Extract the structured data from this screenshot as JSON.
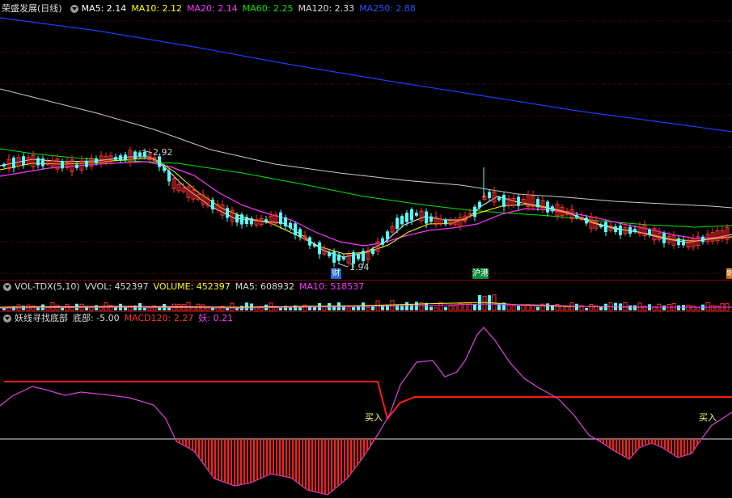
{
  "main": {
    "stock_title": "荣盛发展(日线)",
    "ma5": "MA5: 2.14",
    "ma10": "MA10: 2.12",
    "ma20": "MA20: 2.14",
    "ma60": "MA60: 2.25",
    "ma120": "MA120: 2.33",
    "ma250": "MA250: 2.88",
    "high_label": "2.92",
    "low_label": "1.94",
    "marker_cai": "财",
    "marker_gang": "沪港",
    "marker_right": "融"
  },
  "vol": {
    "title": "VOL-TDX(5,10)",
    "vvol": "VVOL: 452397",
    "volume": "VOLUME: 452397",
    "ma5": "MA5: 608932",
    "ma10": "MA10: 518537"
  },
  "ind": {
    "title": "妖线寻找底部",
    "bottom": "底部: -5.00",
    "macd": "MACD120: 2.27",
    "yao": "妖: 0.21",
    "buy1": "买入",
    "buy2": "买入"
  },
  "colors": {
    "up": "#ff3030",
    "down": "#54ffff",
    "ma5": "#ffffff",
    "ma10": "#ffff00",
    "ma20": "#ff33ff",
    "ma60": "#00e600",
    "ma120": "#c8c8c8",
    "ma250": "#1e3cff"
  },
  "chart_data": [
    {
      "type": "candlestick",
      "title": "荣盛发展(日线)",
      "series": [
        {
          "name": "MA5",
          "last": 2.14
        },
        {
          "name": "MA10",
          "last": 2.12
        },
        {
          "name": "MA20",
          "last": 2.14
        },
        {
          "name": "MA60",
          "last": 2.25
        },
        {
          "name": "MA120",
          "last": 2.33
        },
        {
          "name": "MA250",
          "last": 2.88
        }
      ],
      "annotations": [
        {
          "text": "2.92",
          "value": 2.92
        },
        {
          "text": "1.94",
          "value": 1.94
        }
      ]
    },
    {
      "type": "bar",
      "title": "VOL-TDX(5,10)",
      "series": [
        {
          "name": "VVOL",
          "last": 452397
        },
        {
          "name": "VOLUME",
          "last": 452397
        },
        {
          "name": "MA5",
          "last": 608932
        },
        {
          "name": "MA10",
          "last": 518537
        }
      ]
    },
    {
      "type": "line",
      "title": "妖线寻找底部",
      "series": [
        {
          "name": "底部",
          "last": -5.0
        },
        {
          "name": "MACD120",
          "last": 2.27
        },
        {
          "name": "妖",
          "last": 0.21
        }
      ]
    }
  ]
}
